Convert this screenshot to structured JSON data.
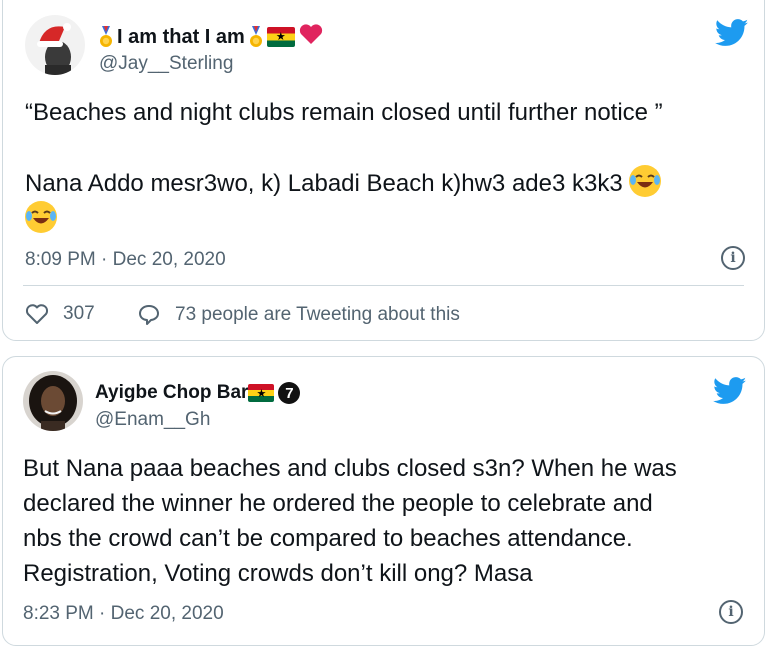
{
  "tweets": [
    {
      "display_name": "I am that I am",
      "handle": "@Jay__Sterling",
      "text_lines": [
        "“Beaches and night clubs remain closed until further notice ”",
        "",
        "Nana Addo mesr3wo, k) Labadi Beach k)hw3 ade3 k3k3"
      ],
      "emoji": "face-with-tears-of-joy",
      "timestamp": "8:09 PM · Dec 20, 2020",
      "likes": "307",
      "activity": "73 people are Tweeting about this"
    },
    {
      "display_name": "Ayigbe Chop Bar",
      "handle": "@Enam__Gh",
      "badge": "7",
      "text_lines": [
        "But Nana paaa beaches and clubs closed s3n? When he was",
        "declared the winner he ordered the people to celebrate and",
        "nbs the crowd can’t be compared to beaches attendance.",
        "Registration, Voting crowds don’t kill ong? Masa"
      ],
      "timestamp": "8:23 PM · Dec 20, 2020"
    }
  ],
  "colors": {
    "twitter_blue": "#1d9bf0",
    "text": "#0f1419",
    "muted": "#536471",
    "border": "#cfd9de",
    "heart_red": "#e0245e"
  }
}
